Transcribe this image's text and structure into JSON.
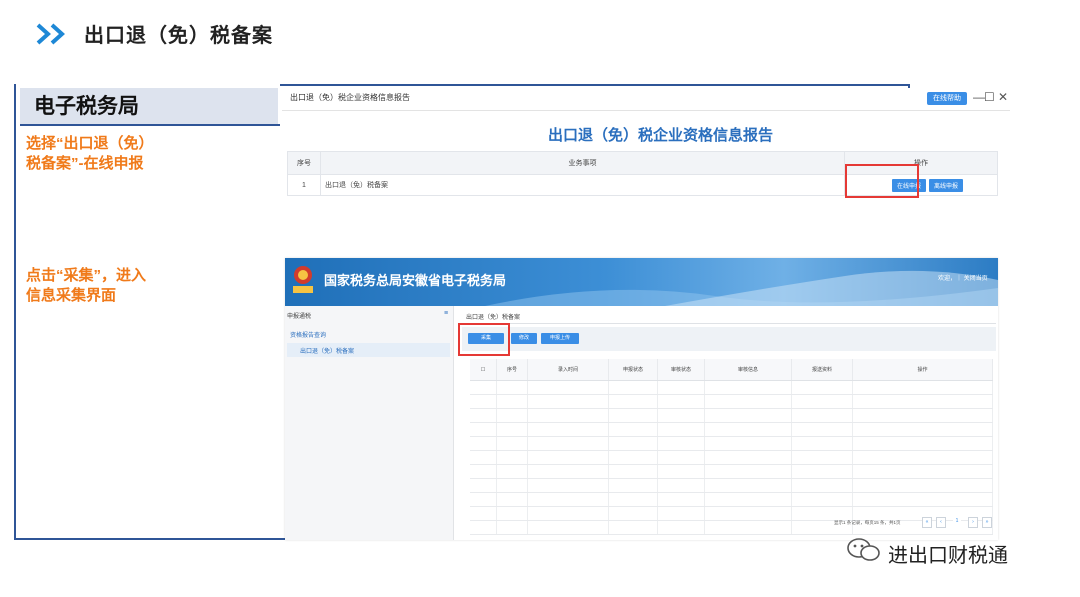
{
  "header": {
    "title": "出口退（免）税备案"
  },
  "left_panel": {
    "brand": "电子税务局",
    "step1": "选择“出口退（免）\n税备案”-在线申报",
    "step2": "点击“采集”，进入\n信息采集界面"
  },
  "screen1": {
    "window_title": "出口退（免）税企业资格信息报告",
    "help_button": "在线帮助",
    "window_controls": [
      "—",
      "☐",
      "✕"
    ],
    "report_title": "出口退（免）税企业资格信息报告",
    "columns": [
      "序号",
      "业务事项",
      "操作"
    ],
    "rows": [
      {
        "no": "1",
        "item": "出口退（免）税备案",
        "online_btn": "在线申报",
        "offline_btn": "离线申报"
      }
    ]
  },
  "screen2": {
    "banner_title": "国家税务总局安徽省电子税务局",
    "banner_right": "欢迎，｜ 关闭当页",
    "sidebar_title": "申报通税",
    "menu_group": "资格报告查询",
    "menu_item": "出口退（免）税备案",
    "breadcrumb": "出口退（免）税备案",
    "toolbar": {
      "collect": "采集",
      "modify": "修改",
      "upload": "申报上传"
    },
    "columns": [
      "序号",
      "录入时间",
      "申报状态",
      "审核状态",
      "审核信息",
      "报送资料",
      "操作"
    ],
    "pager_text": "显示1 条记录，每页15 条，共1页",
    "page_num": "1"
  },
  "watermark": {
    "text": "进出口财税通"
  },
  "colors": {
    "accent_blue": "#2f5597",
    "step_orange": "#f07a1a",
    "button_blue": "#3a8ee6",
    "highlight_red": "#e53935"
  }
}
